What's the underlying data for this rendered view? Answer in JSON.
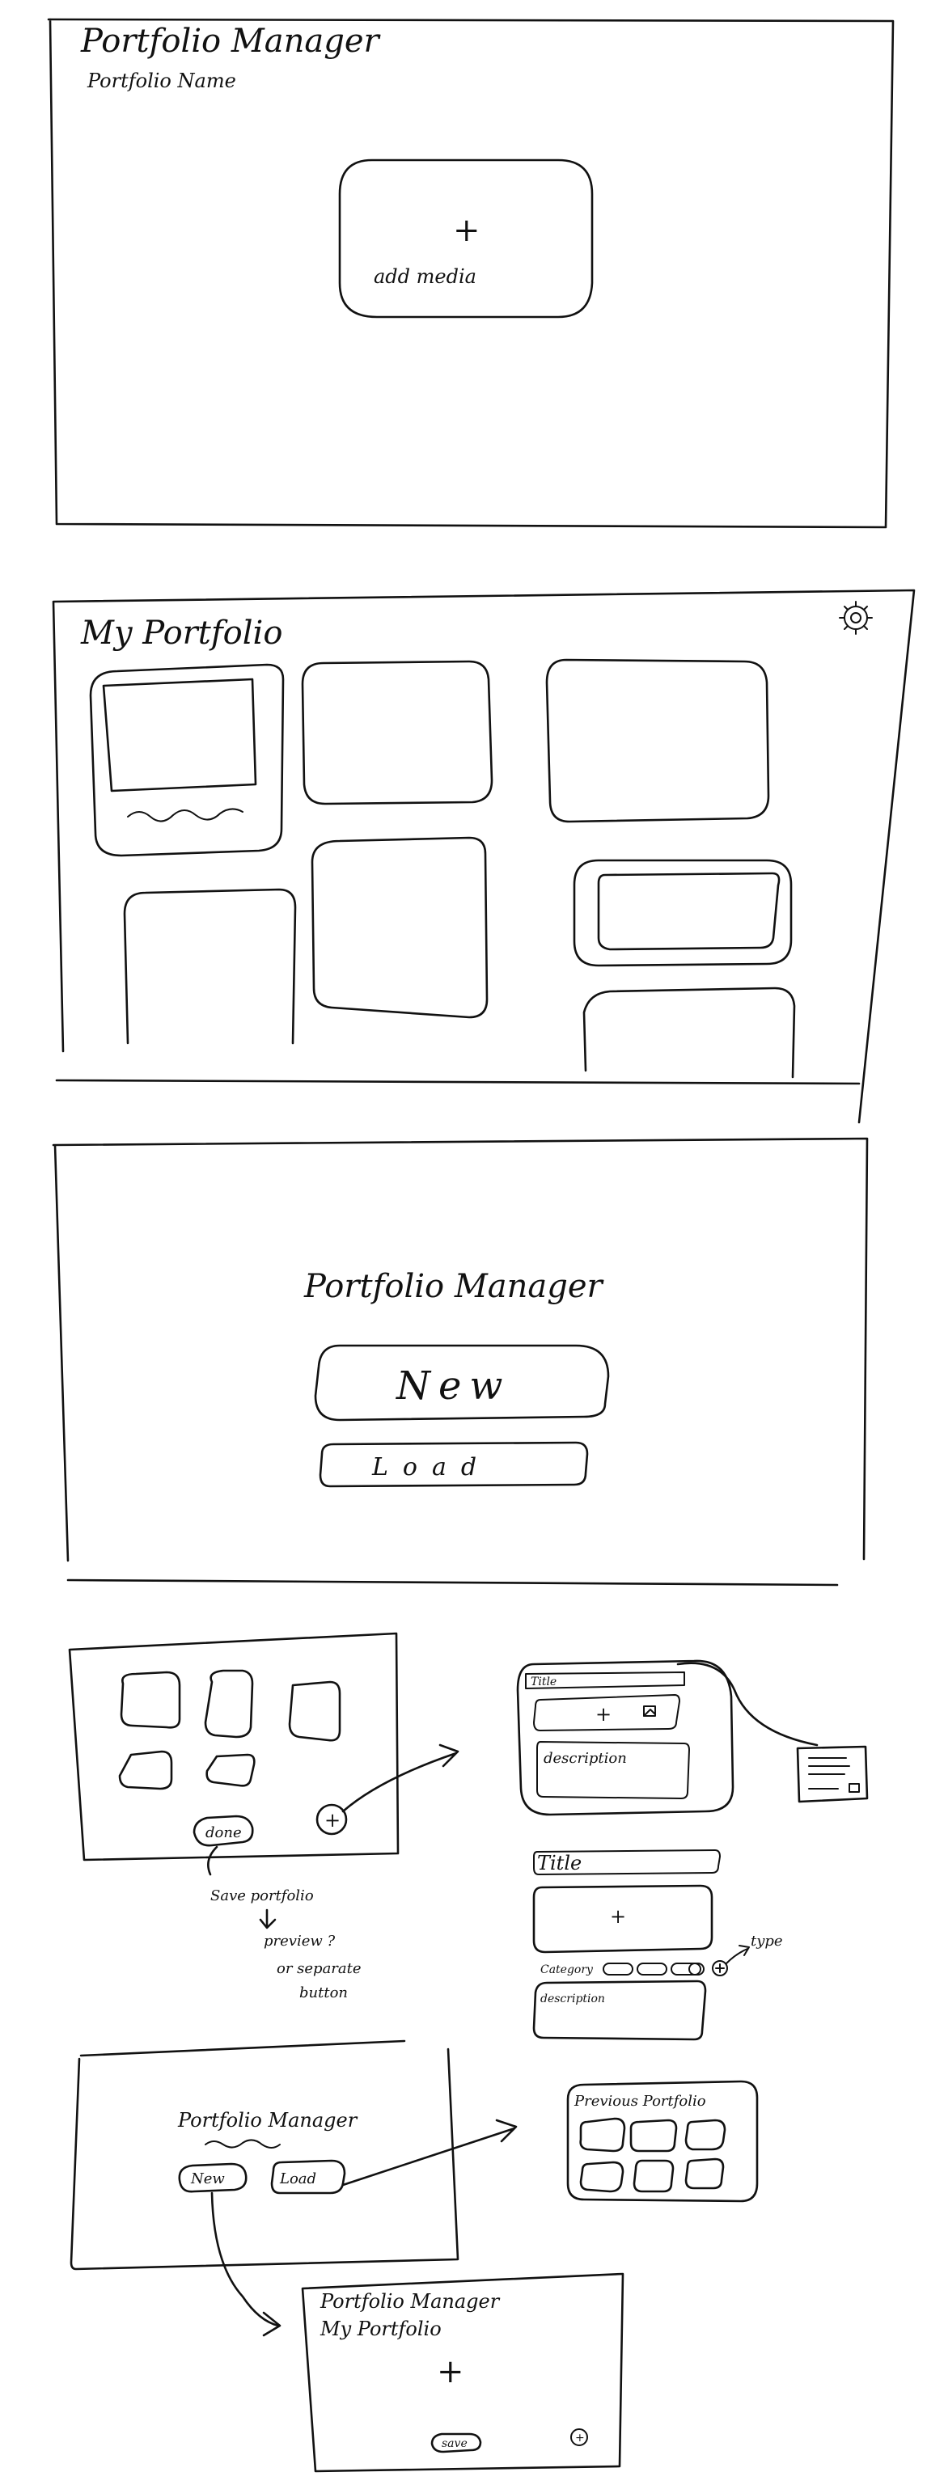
{
  "frame1": {
    "title": "Portfolio Manager",
    "subtitle": "Portfolio Name",
    "add_symbol": "+",
    "add_label": "add media"
  },
  "frame2": {
    "title": "My Portfolio",
    "settings_icon": "gear-icon"
  },
  "frame3": {
    "title": "Portfolio Manager",
    "new_label": "New",
    "load_label": "Load"
  },
  "flow1": {
    "done_label": "done",
    "add_symbol": "+",
    "note": [
      "Save portfolio",
      "preview ?",
      "or separate",
      "button"
    ]
  },
  "dialog1": {
    "title_label": "Title",
    "add_symbol": "+",
    "description_label": "description"
  },
  "dialog2": {
    "title_label": "Title",
    "add_symbol": "+",
    "category_label": "Category",
    "type_label": "type",
    "description_label": "description"
  },
  "flow2": {
    "title": "Portfolio Manager",
    "new_label": "New",
    "load_label": "Load"
  },
  "preview": {
    "title": "Previous Portfolio"
  },
  "frame4": {
    "title": "Portfolio Manager",
    "subtitle": "My Portfolio",
    "add_symbol": "+",
    "save_label": "save",
    "plus_circle": "+"
  }
}
